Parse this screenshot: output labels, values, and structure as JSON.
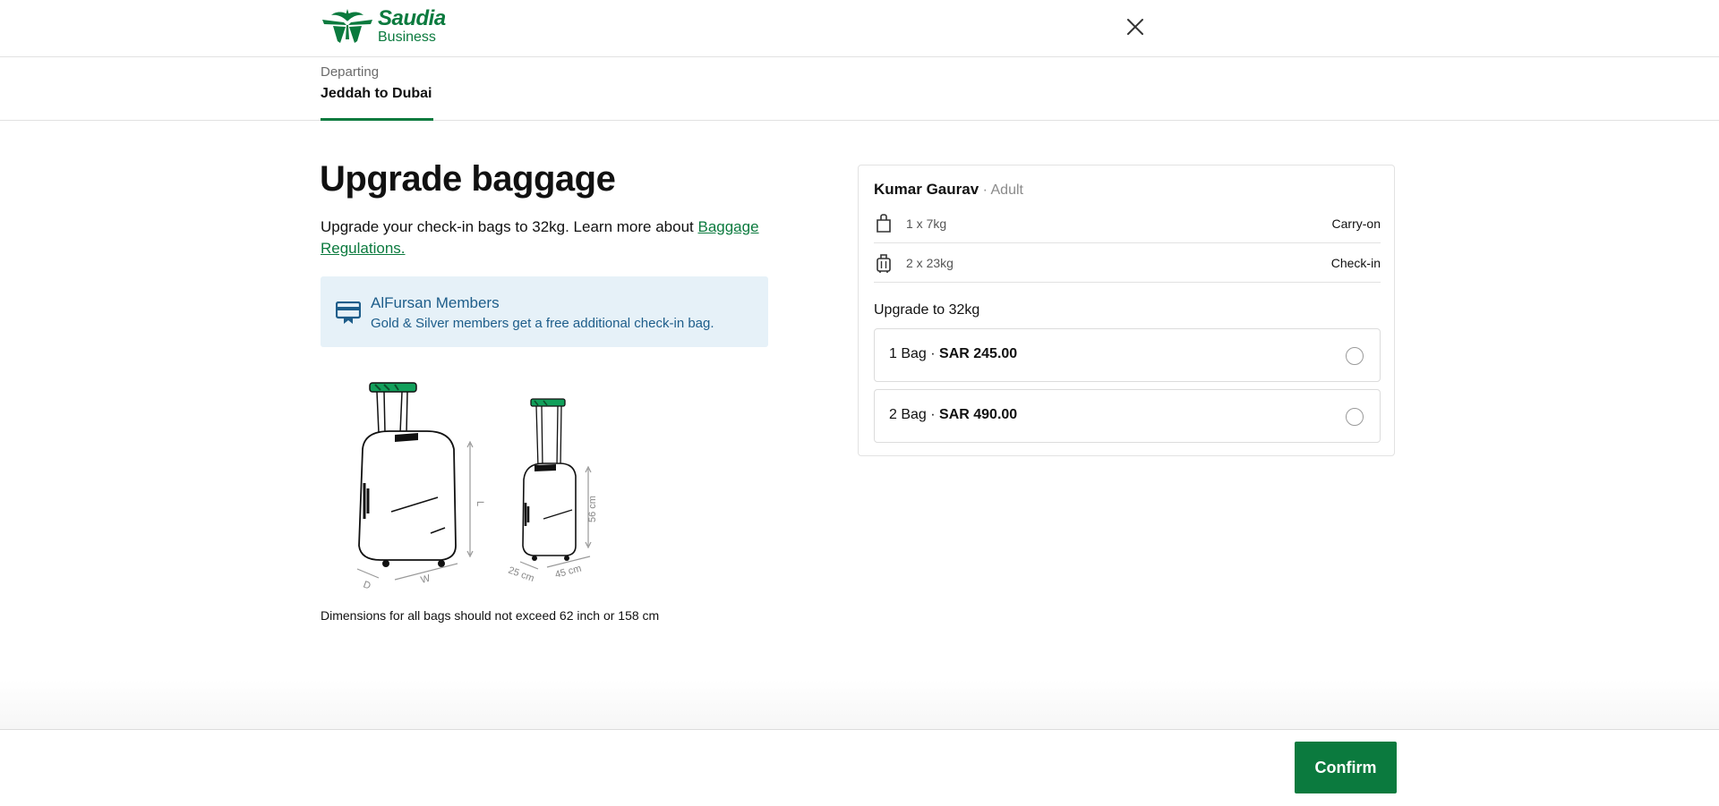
{
  "header": {
    "brand": "Saudia",
    "brand_sub": "Business",
    "close_icon": "close-icon"
  },
  "tabs": [
    {
      "overline": "Departing",
      "label": "Jeddah to Dubai",
      "active": true
    }
  ],
  "main": {
    "title": "Upgrade baggage",
    "desc_prefix": "Upgrade your check-in bags to 32kg. Learn more about ",
    "desc_link": "Baggage Regulations.",
    "info": {
      "title": "AlFursan Members",
      "body": "Gold & Silver members get a free additional check-in bag.",
      "icon": "membership-card-icon"
    },
    "illustration": {
      "large": {
        "height": "L",
        "depth": "D",
        "width": "W"
      },
      "small": {
        "height": "56 cm",
        "depth": "25 cm",
        "width": "45 cm"
      }
    },
    "dims_note": "Dimensions for all bags should not exceed 62 inch or 158 cm"
  },
  "card": {
    "passenger_name": "Kumar Gaurav",
    "passenger_type": " · Adult",
    "allowances": [
      {
        "qty": "1 x 7kg",
        "kind": "Carry-on",
        "icon": "carry-on-bag-icon"
      },
      {
        "qty": "2 x 23kg",
        "kind": "Check-in",
        "icon": "check-in-suitcase-icon"
      }
    ],
    "upgrade_title": "Upgrade to 32kg",
    "options": [
      {
        "count": "1 Bag · ",
        "price": "SAR 245.00",
        "selected": false
      },
      {
        "count": "2 Bag · ",
        "price": "SAR 490.00",
        "selected": false
      }
    ]
  },
  "footer": {
    "confirm_label": "Confirm"
  },
  "colors": {
    "brand_green": "#0b7a3e",
    "info_bg": "#e6f1f8",
    "info_text": "#1d5d8a"
  }
}
